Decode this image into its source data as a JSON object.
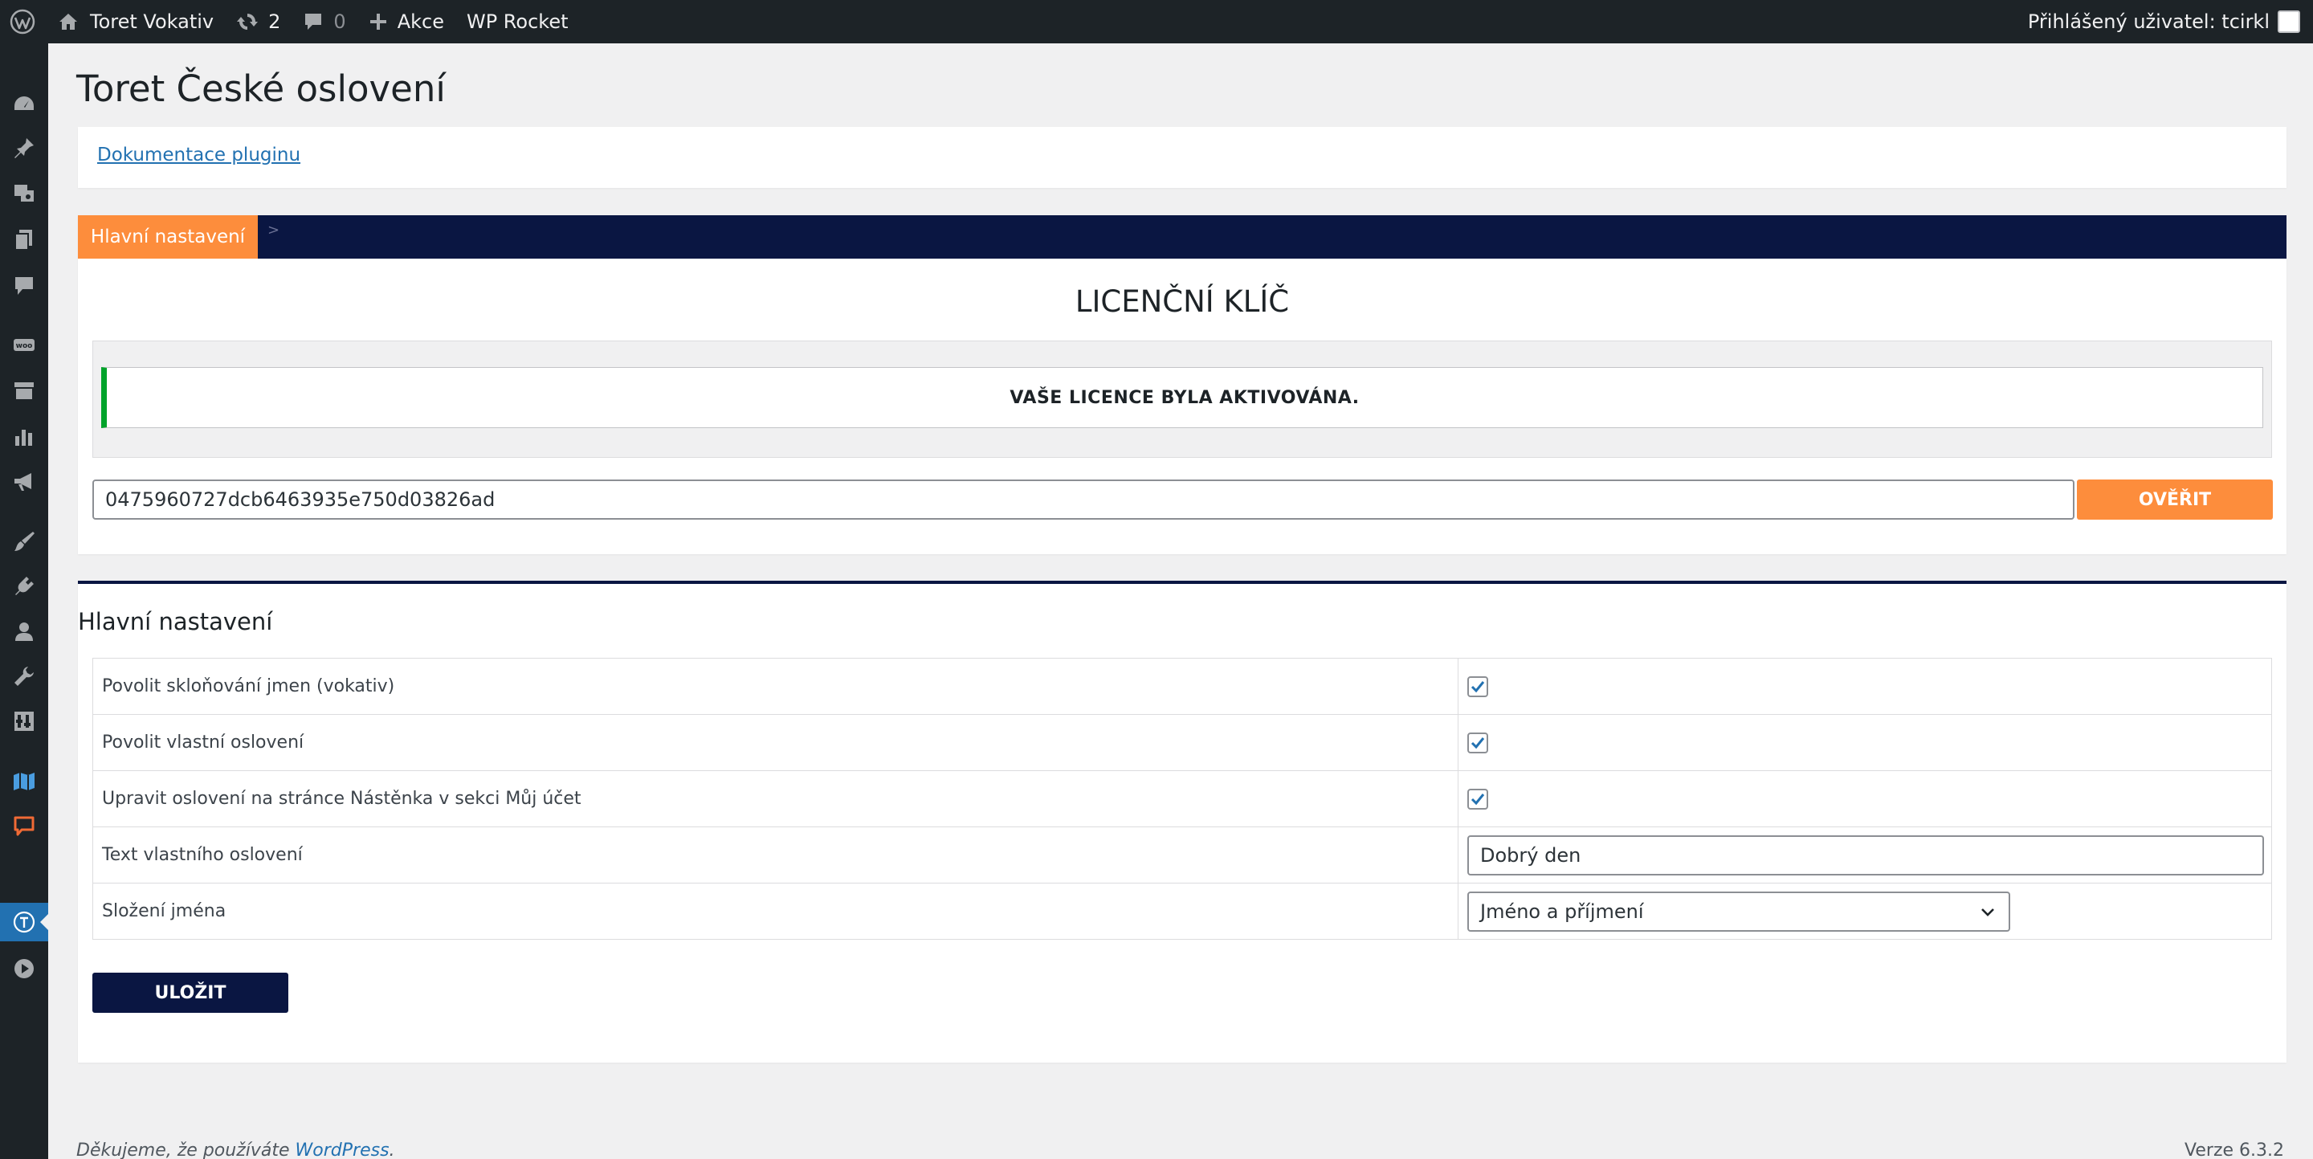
{
  "adminbar": {
    "site_name": "Toret Vokativ",
    "updates_count": "2",
    "comments_count": "0",
    "new_label": "Akce",
    "wp_rocket_label": "WP Rocket",
    "user_greeting": "Přihlášený uživatel: tcirkl"
  },
  "sidemenu": {
    "icons": [
      "dashboard-icon",
      "pin-icon",
      "media-icon",
      "pages-icon",
      "comments-icon",
      "woo-icon",
      "archive-icon",
      "chart-icon",
      "megaphone-icon",
      "appearance-icon",
      "plugins-icon",
      "users-icon",
      "tools-icon",
      "settings-icon",
      "map-icon",
      "chat-icon",
      "toret-icon",
      "play-icon"
    ],
    "current": "toret-icon"
  },
  "page": {
    "title": "Toret České oslovení",
    "doc_link": "Dokumentace pluginu"
  },
  "license": {
    "tab_active": "Hlavní nastavení",
    "tab_separator": ">",
    "title": "LICENČNÍ KLÍČ",
    "notice": "VAŠE LICENCE BYLA AKTIVOVÁNA.",
    "key_value": "0475960727dcb6463935e750d03826ad",
    "verify_button": "OVĚŘIT"
  },
  "settings": {
    "title": "Hlavní nastavení",
    "rows": [
      {
        "label": "Povolit skloňování jmen (vokativ)",
        "type": "checkbox",
        "checked": true
      },
      {
        "label": "Povolit vlastní oslovení",
        "type": "checkbox",
        "checked": true
      },
      {
        "label": "Upravit oslovení na stránce Nástěnka v sekci Můj účet",
        "type": "checkbox",
        "checked": true
      },
      {
        "label": "Text vlastního oslovení",
        "type": "text",
        "value": "Dobrý den"
      },
      {
        "label": "Složení jména",
        "type": "select",
        "value": "Jméno a příjmení"
      }
    ],
    "save_button": "ULOŽIT"
  },
  "footer": {
    "thanks_prefix": "Děkujeme, že používáte ",
    "thanks_link": "WordPress",
    "thanks_suffix": ".",
    "version": "Verze 6.3.2"
  },
  "colors": {
    "accent_orange": "#fd8d3c",
    "navy": "#0a1642",
    "success_green": "#00a32a",
    "wp_blue": "#2271b1"
  }
}
